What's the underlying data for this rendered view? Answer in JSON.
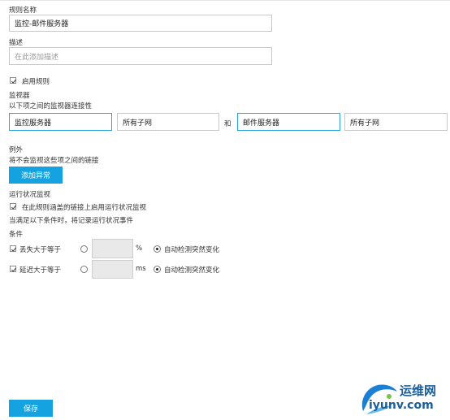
{
  "rule": {
    "name_label": "规则名称",
    "name_value": "监控-邮件服务器",
    "desc_label": "描述",
    "desc_placeholder": "在此添加描述",
    "enable_label": "启用规则"
  },
  "monitor": {
    "title": "监视器",
    "subtitle": "以下项之间的监视器连接性",
    "from_device": "监控服务器",
    "from_subnet": "所有子网",
    "and_label": "和",
    "to_device": "邮件服务器",
    "to_subnet": "所有子网"
  },
  "exceptions": {
    "title": "例外",
    "subtitle": "将不会监视这些项之间的链接",
    "add_button": "添加异常"
  },
  "health": {
    "title": "运行状况监视",
    "enable_label": "在此规则涵盖的链接上启用运行状况监视",
    "note": "当满足以下条件时，将记录运行状况事件"
  },
  "conditions": {
    "title": "条件",
    "rows": [
      {
        "label": "丢失大于等于",
        "unit": "%",
        "auto_label": "自动检测突然变化"
      },
      {
        "label": "延迟大于等于",
        "unit": "ms",
        "auto_label": "自动检测突然变化"
      }
    ]
  },
  "footer": {
    "save_button": "保存"
  },
  "watermark": {
    "brand": "运维网",
    "url": "iyunv.com"
  }
}
